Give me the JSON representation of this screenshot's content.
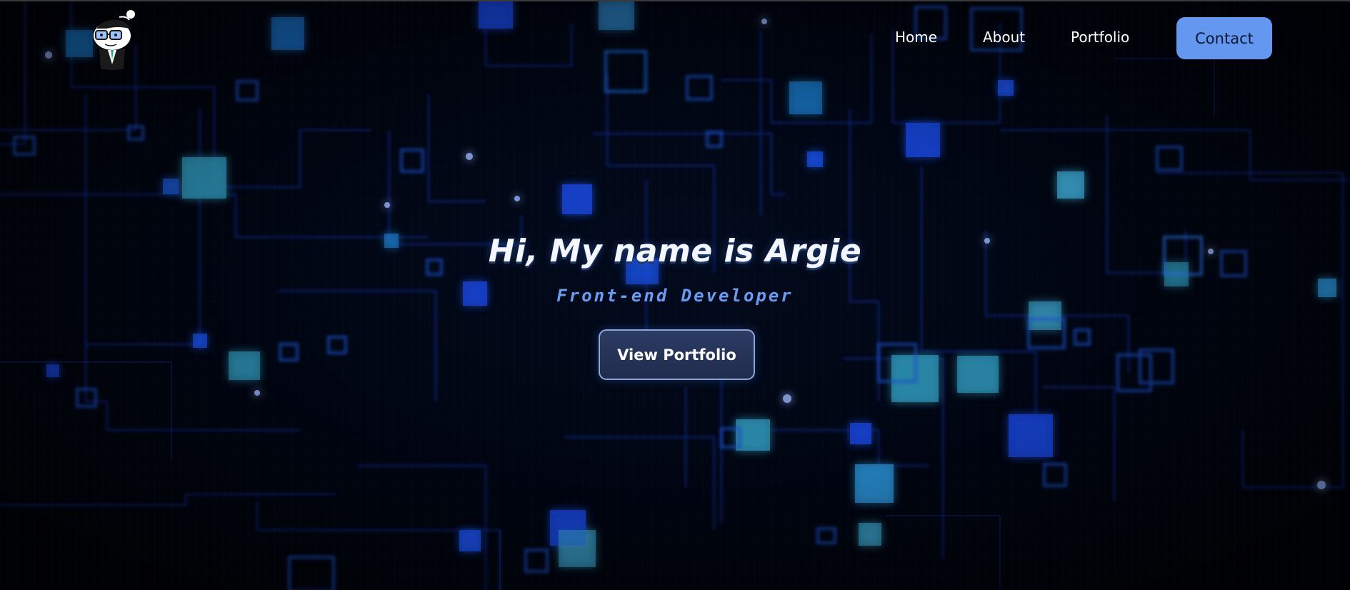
{
  "nav": {
    "logo_icon": "cartoon-mascot-avatar-icon",
    "links": {
      "home": "Home",
      "about": "About",
      "portfolio": "Portfolio",
      "contact": "Contact"
    }
  },
  "hero": {
    "title": "Hi, My name is Argie",
    "subtitle": "Front-end Developer",
    "cta": "View Portfolio"
  },
  "colors": {
    "background": "#000308",
    "accent": "#6497ef",
    "circuit_blue": "#1f4fd8",
    "circuit_cyan": "#3aa0e0"
  }
}
